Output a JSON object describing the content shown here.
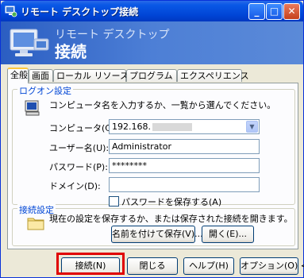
{
  "window": {
    "title": "リモート デスクトップ接続",
    "banner_line1": "リモート デスクトップ",
    "banner_line2": "接続",
    "minimize": "_",
    "maximize": "□",
    "close": "✕"
  },
  "tabs": [
    {
      "label": "全般"
    },
    {
      "label": "画面"
    },
    {
      "label": "ローカル リソース"
    },
    {
      "label": "プログラム"
    },
    {
      "label": "エクスペリエンス"
    }
  ],
  "logon": {
    "group_label": "ログオン設定",
    "instruction": "コンピュータ名を入力するか、一覧から選んでください。",
    "computer_label": "コンピュータ(C):",
    "computer_value": "192.168.",
    "username_label": "ユーザー名(U):",
    "username_value": "Administrator",
    "password_label": "パスワード(P):",
    "password_value": "********",
    "domain_label": "ドメイン(D):",
    "domain_value": "",
    "save_password_label": "パスワードを保存する(A)"
  },
  "connection": {
    "group_label": "接続設定",
    "description": "現在の設定を保存するか、または保存された接続を開きます。",
    "save_as_button": "名前を付けて保存(V)...",
    "open_button": "開く(E)..."
  },
  "footer": {
    "connect_button": "接続(N)",
    "close_button": "閉じる",
    "help_button": "ヘルプ(H)",
    "options_button": "オプション(O) <<"
  },
  "colors": {
    "highlight": "#e00000",
    "titlebar": "#0045d6",
    "group_label": "#0046d5"
  }
}
